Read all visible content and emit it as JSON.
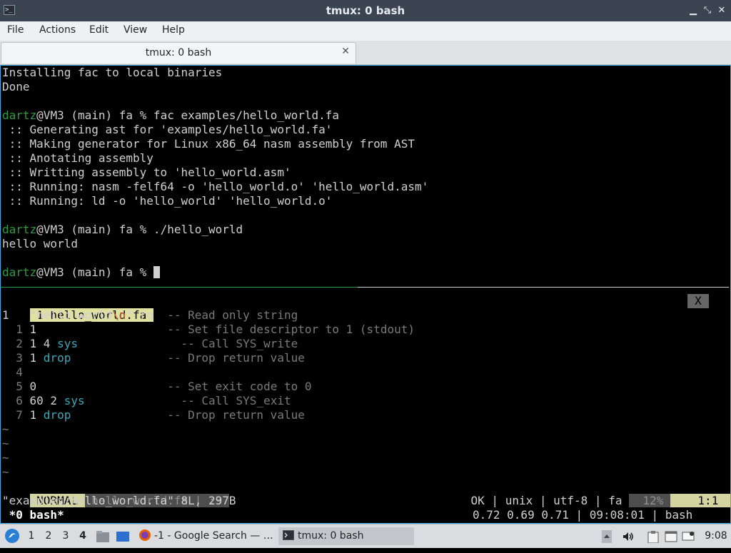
{
  "window": {
    "title": "tmux: 0 bash"
  },
  "menu": [
    "File",
    "Actions",
    "Edit",
    "View",
    "Help"
  ],
  "tab": {
    "label": "tmux: 0 bash",
    "close": "✕"
  },
  "shell": {
    "prompt_user": "dartz",
    "prompt_rest": "@VM3 (main) fa % ",
    "lines": [
      {
        "text": "Installing fac to local binaries"
      },
      {
        "text": "Done"
      },
      {
        "text": ""
      },
      {
        "cmd": "fac examples/hello_world.fa"
      },
      {
        "text": " :: Generating ast for 'examples/hello_world.fa'"
      },
      {
        "text": " :: Making generator for Linux x86_64 nasm assembly from AST"
      },
      {
        "text": " :: Anotating assembly"
      },
      {
        "text": " :: Writting assembly to 'hello_world.asm'"
      },
      {
        "text": " :: Running: nasm -felf64 -o 'hello_world.o' 'hello_world.asm'"
      },
      {
        "text": " :: Running: ld -o 'hello_world' 'hello_world.o'"
      },
      {
        "text": ""
      },
      {
        "cmd": "./hello_world"
      },
      {
        "text": "hello world"
      },
      {
        "text": ""
      },
      {
        "cmd": ""
      }
    ]
  },
  "vim": {
    "tab_label": " 1 hello_world.fa ",
    "close_label": "X",
    "lines": [
      {
        "num": "1 ",
        "parts": [
          [
            "str",
            "  \"hello world"
          ],
          [
            "esc",
            "\\n"
          ],
          [
            "str",
            "\" ro  "
          ],
          [
            "comment",
            "-- Read only string"
          ]
        ]
      },
      {
        "num": "  1 ",
        "parts": [
          [
            "num1",
            "1"
          ],
          [
            "str",
            "                   "
          ],
          [
            "comment",
            "-- Set file descriptor to 1 (stdout)"
          ]
        ]
      },
      {
        "num": "  2 ",
        "parts": [
          [
            "num1",
            "1 4 "
          ],
          [
            "kw",
            "sys"
          ],
          [
            "str",
            "               "
          ],
          [
            "comment",
            "-- Call SYS_write"
          ]
        ]
      },
      {
        "num": "  3 ",
        "parts": [
          [
            "num1",
            "1 "
          ],
          [
            "kw",
            "drop"
          ],
          [
            "str",
            "              "
          ],
          [
            "comment",
            "-- Drop return value"
          ]
        ]
      },
      {
        "num": "  4 ",
        "parts": []
      },
      {
        "num": "  5 ",
        "parts": [
          [
            "num1",
            "0"
          ],
          [
            "str",
            "                   "
          ],
          [
            "comment",
            "-- Set exit code to 0"
          ]
        ]
      },
      {
        "num": "  6 ",
        "parts": [
          [
            "num1",
            "60 2 "
          ],
          [
            "kw",
            "sys"
          ],
          [
            "str",
            "              "
          ],
          [
            "comment",
            "-- Call SYS_exit"
          ]
        ]
      },
      {
        "num": "  7 ",
        "parts": [
          [
            "num1",
            "1 "
          ],
          [
            "kw",
            "drop"
          ],
          [
            "str",
            "              "
          ],
          [
            "comment",
            "-- Drop return value"
          ]
        ]
      }
    ],
    "tildes": [
      "~",
      "~",
      "~",
      "~"
    ],
    "statusline": {
      "mode": " NORMAL ",
      "file": " hello_world.fa | :3 ",
      "right": "OK | unix | utf-8 | fa ",
      "percent": "  12% ",
      "position": "    1:1   "
    },
    "message": "\"examples/hello_world.fa\" 8L, 297B"
  },
  "tmux_status": {
    "left": " *0 bash*",
    "right": "0.72 0.69 0.71 | 09:08:01 | bash "
  },
  "taskbar": {
    "workspaces": [
      "1",
      "2",
      "3",
      "4"
    ],
    "active_workspace": "4",
    "tasks": [
      {
        "label": "-1 - Google Search — …",
        "icon": "firefox-icon"
      },
      {
        "label": "tmux: 0 bash",
        "icon": "terminal-icon"
      }
    ],
    "clock": "9:08"
  }
}
